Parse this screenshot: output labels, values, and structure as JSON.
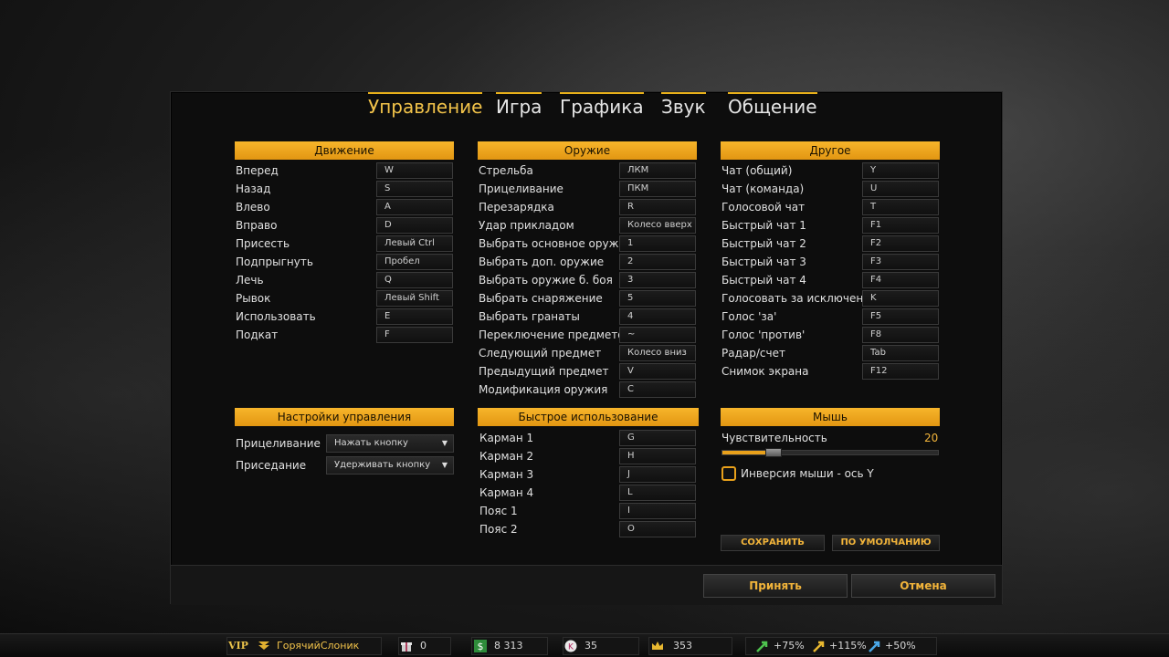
{
  "tabs": [
    {
      "label": "Управление"
    },
    {
      "label": "Игра"
    },
    {
      "label": "Графика"
    },
    {
      "label": "Звук"
    },
    {
      "label": "Общение"
    }
  ],
  "movement": {
    "title": "Движение",
    "rows": [
      {
        "action": "Вперед",
        "key": "W"
      },
      {
        "action": "Назад",
        "key": "S"
      },
      {
        "action": "Влево",
        "key": "A"
      },
      {
        "action": "Вправо",
        "key": "D"
      },
      {
        "action": "Присесть",
        "key": "Левый Ctrl"
      },
      {
        "action": "Подпрыгнуть",
        "key": "Пробел"
      },
      {
        "action": "Лечь",
        "key": "Q"
      },
      {
        "action": "Рывок",
        "key": "Левый Shift"
      },
      {
        "action": "Использовать",
        "key": "E"
      },
      {
        "action": "Подкат",
        "key": "F"
      }
    ]
  },
  "weapons": {
    "title": "Оружие",
    "rows": [
      {
        "action": "Стрельба",
        "key": "ЛКМ"
      },
      {
        "action": "Прицеливание",
        "key": "ПКМ"
      },
      {
        "action": "Перезарядка",
        "key": "R"
      },
      {
        "action": "Удар прикладом",
        "key": "Колесо вверх"
      },
      {
        "action": "Выбрать основное оружие",
        "key": "1"
      },
      {
        "action": "Выбрать доп. оружие",
        "key": "2"
      },
      {
        "action": "Выбрать оружие б. боя",
        "key": "3"
      },
      {
        "action": "Выбрать снаряжение",
        "key": "5"
      },
      {
        "action": "Выбрать гранаты",
        "key": "4"
      },
      {
        "action": "Переключение предметов",
        "key": "~"
      },
      {
        "action": "Следующий предмет",
        "key": "Колесо вниз"
      },
      {
        "action": "Предыдущий предмет",
        "key": "V"
      },
      {
        "action": "Модификация оружия",
        "key": "C"
      }
    ]
  },
  "other": {
    "title": "Другое",
    "rows": [
      {
        "action": "Чат (общий)",
        "key": "Y"
      },
      {
        "action": "Чат (команда)",
        "key": "U"
      },
      {
        "action": "Голосовой чат",
        "key": "T"
      },
      {
        "action": "Быстрый чат 1",
        "key": "F1"
      },
      {
        "action": "Быстрый чат 2",
        "key": "F2"
      },
      {
        "action": "Быстрый чат 3",
        "key": "F3"
      },
      {
        "action": "Быстрый чат 4",
        "key": "F4"
      },
      {
        "action": "Голосовать за исключение",
        "key": "K"
      },
      {
        "action": "Голос 'за'",
        "key": "F5"
      },
      {
        "action": "Голос 'против'",
        "key": "F8"
      },
      {
        "action": "Радар/счет",
        "key": "Tab"
      },
      {
        "action": "Снимок экрана",
        "key": "F12"
      }
    ]
  },
  "control_settings": {
    "title": "Настройки управления",
    "rows": [
      {
        "label": "Прицеливание",
        "value": "Нажать кнопку"
      },
      {
        "label": "Приседание",
        "value": "Удерживать кнопку"
      }
    ]
  },
  "quick_use": {
    "title": "Быстрое использование",
    "rows": [
      {
        "action": "Карман 1",
        "key": "G"
      },
      {
        "action": "Карман 2",
        "key": "H"
      },
      {
        "action": "Карман 3",
        "key": "J"
      },
      {
        "action": "Карман 4",
        "key": "L"
      },
      {
        "action": "Пояс 1",
        "key": "I"
      },
      {
        "action": "Пояс 2",
        "key": "O"
      }
    ]
  },
  "mouse": {
    "title": "Мышь",
    "sensitivity_label": "Чувствительность",
    "sensitivity_value": "20",
    "sensitivity_fraction": 0.2,
    "invert_label": "Инверсия мыши - ось Y",
    "invert_checked": false,
    "save_label": "СОХРАНИТЬ",
    "default_label": "ПО УМОЛЧАНИЮ"
  },
  "actions": {
    "accept_label": "Принять",
    "cancel_label": "Отмена"
  },
  "statusbar": {
    "vip": "VIP",
    "nickname": "ГорячийСлоник",
    "gifts": "0",
    "money": "8 313",
    "kredits": "35",
    "crowns": "353",
    "boost1": "+75%",
    "boost2": "+115%",
    "boost3": "+50%"
  },
  "colors": {
    "accent": "#f2b43a",
    "header": "#f0a820"
  }
}
